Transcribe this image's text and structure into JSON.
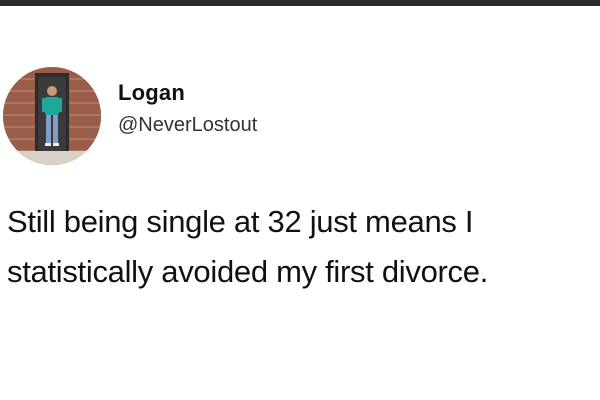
{
  "author": {
    "display_name": "Logan",
    "handle": "@NeverLostout",
    "avatar_icon": "user-avatar-photo"
  },
  "tweet": {
    "lines": [
      "Still being single at 32 just means I",
      "statistically avoided my first divorce."
    ]
  },
  "colors": {
    "background": "#ffffff",
    "text": "#111111",
    "handle": "#333333",
    "top_bar": "#2a2a2a"
  }
}
